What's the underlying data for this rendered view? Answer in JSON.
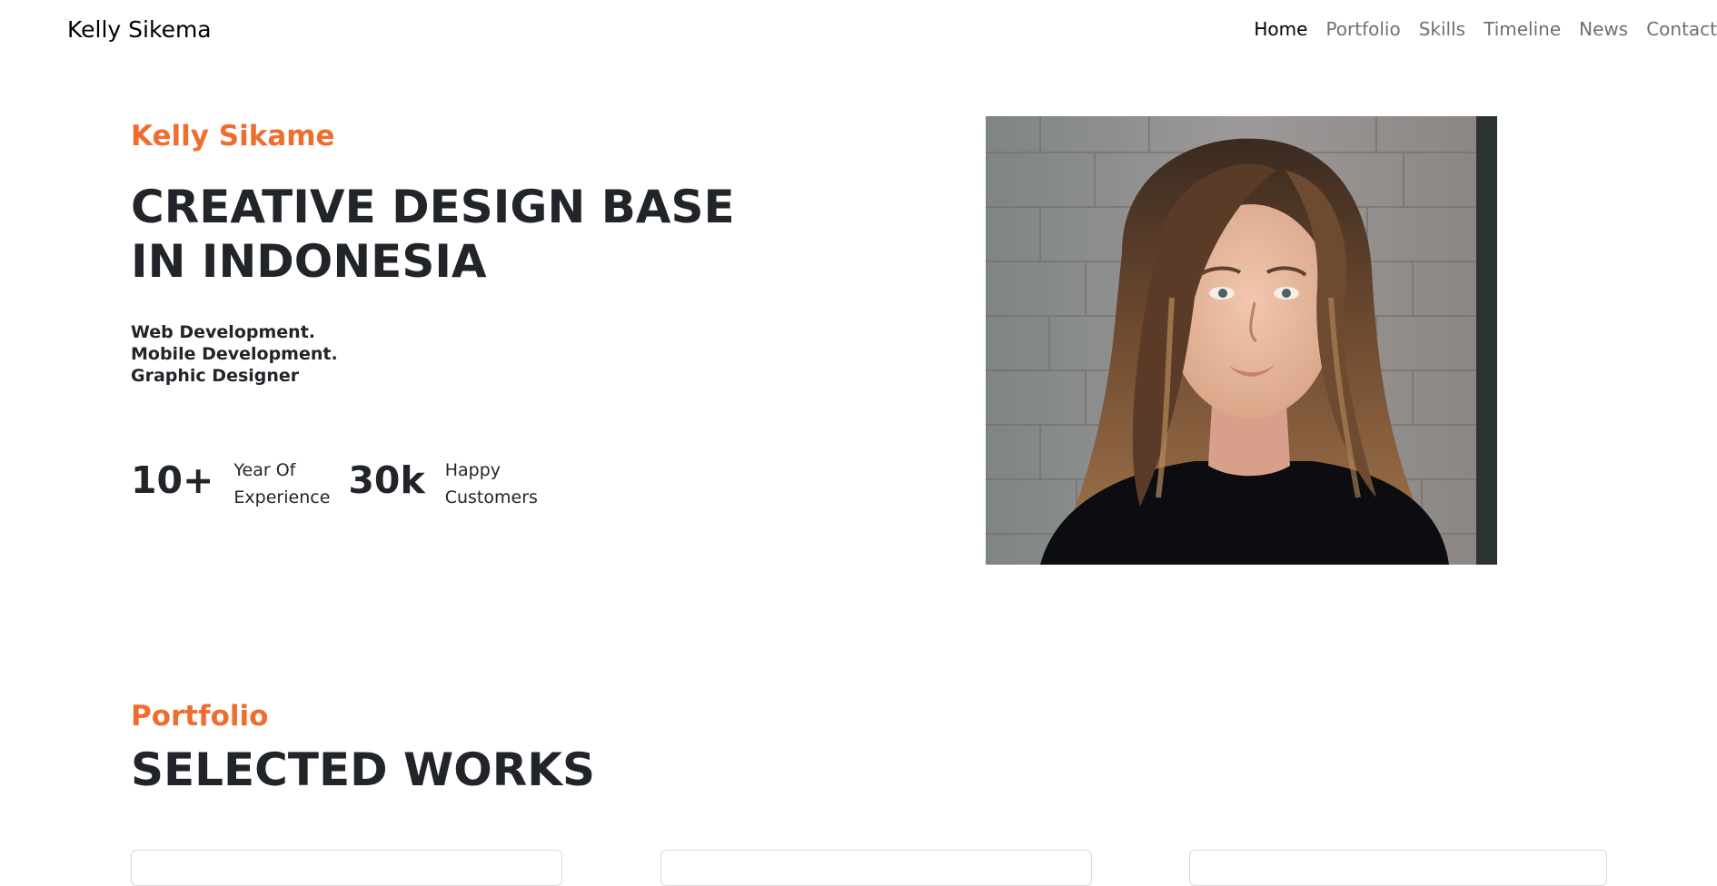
{
  "nav": {
    "brand": "Kelly Sikema",
    "links": [
      {
        "label": "Home",
        "active": true
      },
      {
        "label": "Portfolio",
        "active": false
      },
      {
        "label": "Skills",
        "active": false
      },
      {
        "label": "Timeline",
        "active": false
      },
      {
        "label": "News",
        "active": false
      },
      {
        "label": "Contact",
        "active": false
      }
    ]
  },
  "hero": {
    "kicker": "Kelly Sikame",
    "title": "CREATIVE DESIGN BASE IN INDONESIA",
    "roles": [
      "Web Development.",
      "Mobile Development.",
      "Graphic Designer"
    ],
    "stats": [
      {
        "number": "10+",
        "label_line1": "Year Of",
        "label_line2": "Experience"
      },
      {
        "number": "30k",
        "label_line1": "Happy",
        "label_line2": "Customers"
      }
    ]
  },
  "portfolio": {
    "kicker": "Portfolio",
    "title": "SELECTED WORKS"
  },
  "colors": {
    "accent": "#ef6d2f",
    "text": "#212529",
    "nav_inactive": "#707070"
  }
}
